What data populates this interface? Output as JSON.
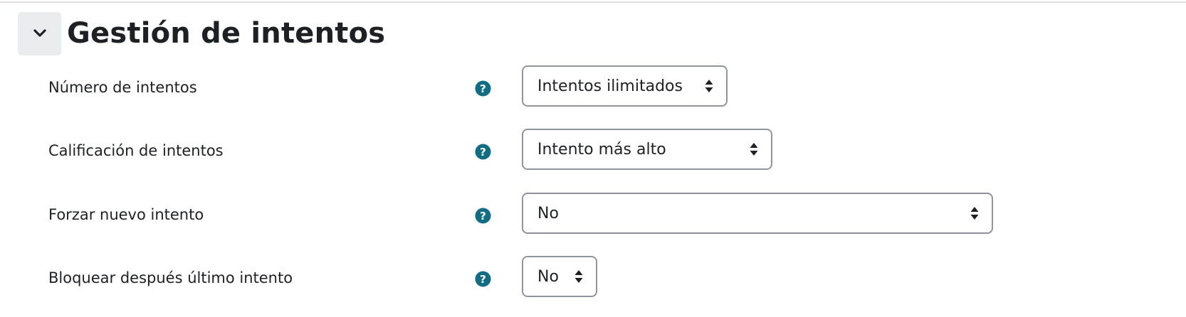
{
  "section": {
    "title": "Gestión de intentos"
  },
  "rows": [
    {
      "label": "Número de intentos",
      "value": "Intentos ilimitados"
    },
    {
      "label": "Calificación de intentos",
      "value": "Intento más alto"
    },
    {
      "label": "Forzar nuevo intento",
      "value": "No"
    },
    {
      "label": "Bloquear después último intento",
      "value": "No"
    }
  ],
  "colors": {
    "help_icon": "#0f6e84",
    "select_border": "#8f959e",
    "collapse_bg": "#e9ecef",
    "text": "#1d2125"
  },
  "icons": {
    "collapse": "chevron-down-icon",
    "help": "question-circle-icon",
    "select": "sort-caret-icon"
  }
}
